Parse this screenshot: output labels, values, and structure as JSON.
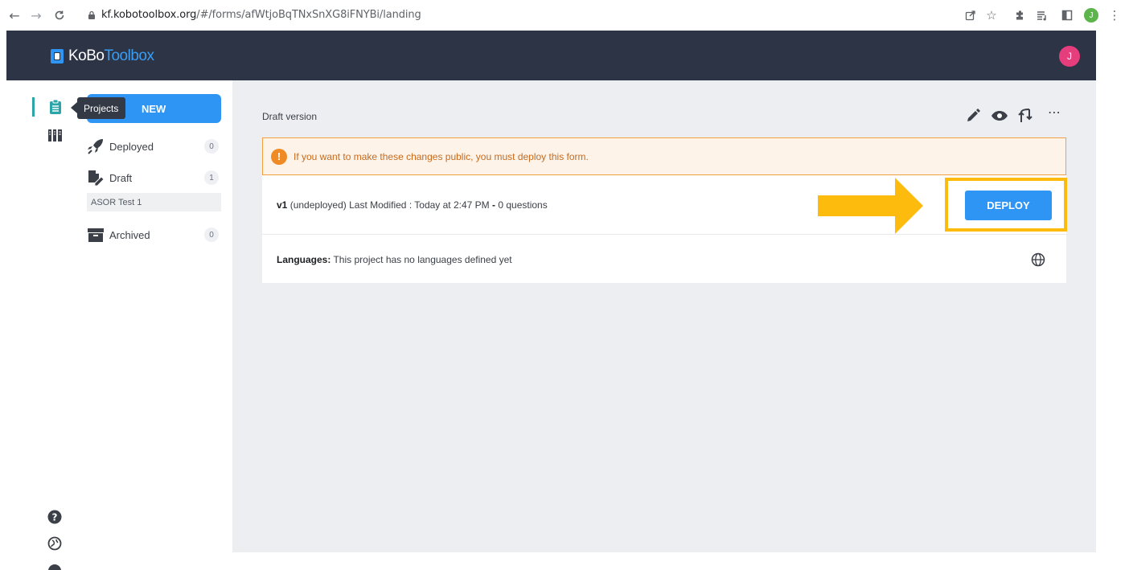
{
  "browser": {
    "url_host": "kf.kobotoolbox.org",
    "url_path": "/#/forms/afWtjoBqTNxSnXG8iFNYBi/landing",
    "back_icon": "arrow-left-icon",
    "forward_icon": "arrow-right-icon",
    "reload_icon": "reload-icon",
    "profile_initial": "J"
  },
  "header": {
    "logo_part1": "KoBo",
    "logo_part2": "Toolbox",
    "avatar_initial": "J"
  },
  "sidebar": {
    "new_label": "NEW",
    "tooltip": "Projects",
    "items": [
      {
        "label": "Deployed",
        "count": "0",
        "icon": "rocket-icon"
      },
      {
        "label": "Draft",
        "count": "1",
        "icon": "draft-icon"
      },
      {
        "label": "Archived",
        "count": "0",
        "icon": "archive-icon"
      }
    ],
    "draft_sub_item": "ASOR Test 1"
  },
  "main": {
    "draft_title": "Draft version",
    "alert_text": "If you want to make these changes public, you must deploy this form.",
    "version": {
      "label": "v1",
      "status": "(undeployed)",
      "meta": "Last Modified : Today at 2:47 PM",
      "sep": "-",
      "questions": "0 questions"
    },
    "deploy_label": "DEPLOY",
    "languages_label": "Languages:",
    "languages_text": "This project has no languages defined yet"
  },
  "colors": {
    "header_bg": "#2c3445",
    "accent_blue": "#2e95f5",
    "highlight_yellow": "#fdbb0e",
    "alert_orange": "#f08a24",
    "avatar_pink": "#e63d7d"
  }
}
